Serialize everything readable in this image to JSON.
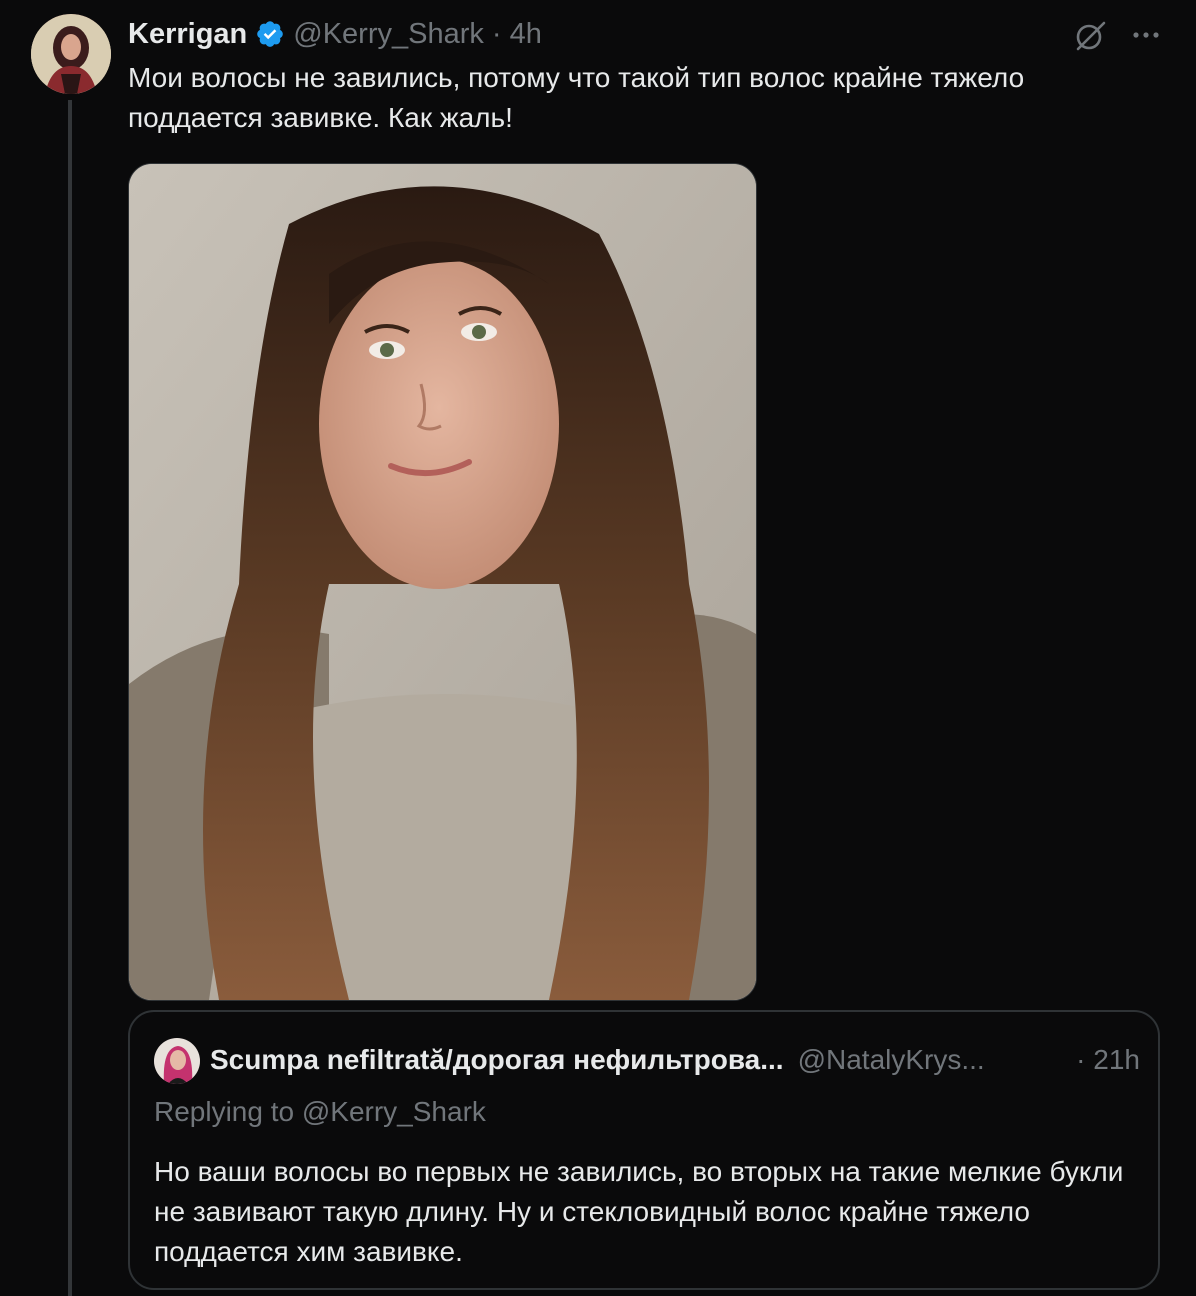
{
  "tweet": {
    "display_name": "Kerrigan",
    "handle": "@Kerry_Shark",
    "separator": "·",
    "time": "4h",
    "text": "Мои волосы не завились, потому что такой тип волос крайне тяжело поддается завивке. Как жаль!",
    "icons": {
      "verified": "verified-badge-icon",
      "grok": "grok-icon",
      "more": "more-options-icon"
    },
    "accent_color": "#1d9bf0"
  },
  "quoted_tweet": {
    "display_name": "Scumpa nefiltrată/дорогая нефильтрова...",
    "handle": "@NatalyKrys...",
    "time": "· 21h",
    "replying_to": "Replying to @Kerry_Shark",
    "text": "Но ваши волосы во первых не завились, во вторых на такие мелкие букли не завивают такую длину. Ну и стекловидный волос крайне тяжело поддается хим завивке."
  }
}
